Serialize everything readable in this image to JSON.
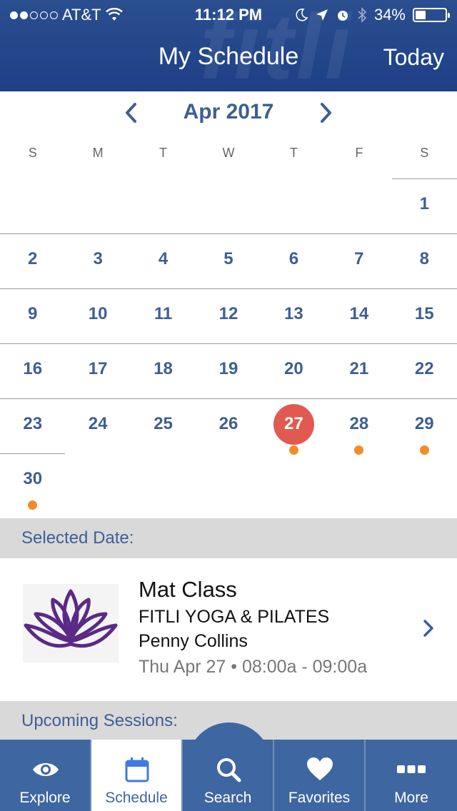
{
  "status": {
    "carrier": "AT&T",
    "time": "11:12 PM",
    "battery": "34%",
    "battery_level": 0.34,
    "signal_bars": 2
  },
  "header": {
    "title": "My Schedule",
    "today_button": "Today",
    "watermark": "fitli"
  },
  "calendar": {
    "month_label": "Apr 2017",
    "weekdays": [
      "S",
      "M",
      "T",
      "W",
      "T",
      "F",
      "S"
    ],
    "weeks": [
      [
        "",
        "",
        "",
        "",
        "",
        "",
        "1"
      ],
      [
        "2",
        "3",
        "4",
        "5",
        "6",
        "7",
        "8"
      ],
      [
        "9",
        "10",
        "11",
        "12",
        "13",
        "14",
        "15"
      ],
      [
        "16",
        "17",
        "18",
        "19",
        "20",
        "21",
        "22"
      ],
      [
        "23",
        "24",
        "25",
        "26",
        "27",
        "28",
        "29"
      ],
      [
        "30",
        "",
        "",
        "",
        "",
        "",
        ""
      ]
    ],
    "selected_day": "27",
    "event_days": [
      "27",
      "28",
      "29",
      "30"
    ]
  },
  "selected_section": {
    "heading": "Selected Date:"
  },
  "session": {
    "title": "Mat Class",
    "studio": "FITLI YOGA & PILATES",
    "instructor": "Penny Collins",
    "time": "Thu Apr 27 • 08:00a - 09:00a"
  },
  "upcoming_section": {
    "heading": "Upcoming Sessions:"
  },
  "tabs": [
    {
      "label": "Explore",
      "icon": "eye-icon"
    },
    {
      "label": "Schedule",
      "icon": "calendar-icon"
    },
    {
      "label": "Search",
      "icon": "search-icon"
    },
    {
      "label": "Favorites",
      "icon": "heart-icon"
    },
    {
      "label": "More",
      "icon": "more-icon"
    }
  ],
  "colors": {
    "brand_blue": "#1f3f86",
    "tab_blue": "#3e66a0",
    "text_blue": "#3e5f93",
    "selected_red": "#e05a50",
    "event_orange": "#f28c28"
  }
}
